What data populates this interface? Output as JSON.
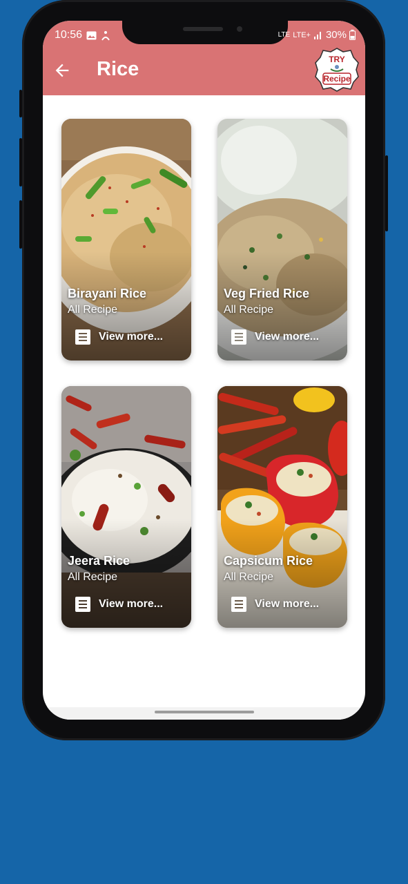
{
  "status_bar": {
    "time": "10:56",
    "network": "LTE",
    "network2": "LTE+",
    "battery": "30%"
  },
  "app_bar": {
    "title": "Rice",
    "logo_text_top": "TRY",
    "logo_text_bottom": "Recipe"
  },
  "cards": [
    {
      "name": "Birayani Rice",
      "subtitle": "All Recipe",
      "action": "View more..."
    },
    {
      "name": "Veg Fried Rice",
      "subtitle": "All Recipe",
      "action": "View more..."
    },
    {
      "name": "Jeera Rice",
      "subtitle": "All Recipe",
      "action": "View more..."
    },
    {
      "name": "Capsicum Rice",
      "subtitle": "All Recipe",
      "action": "View more..."
    }
  ],
  "colors": {
    "background": "#1565a8",
    "app_bar": "#d97374",
    "logo_accent": "#b8242a"
  },
  "icons": [
    "back-arrow-icon",
    "gallery-icon",
    "accessibility-icon",
    "signal-icon",
    "battery-icon",
    "recipe-doc-icon"
  ]
}
